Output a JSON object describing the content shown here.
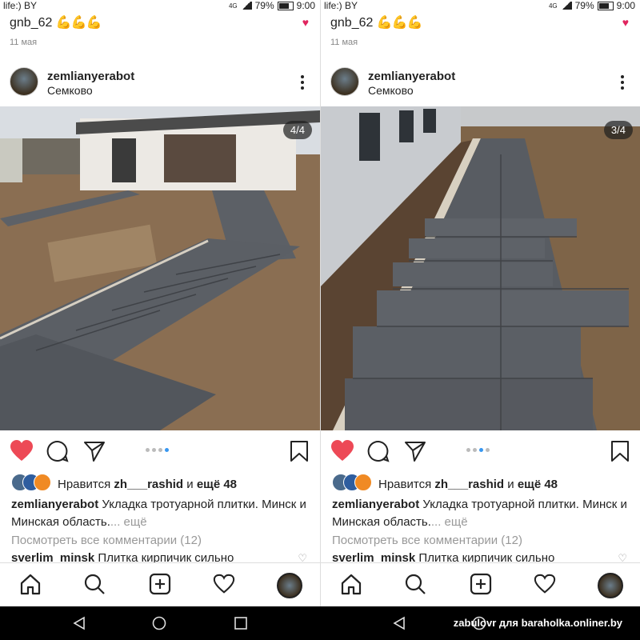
{
  "panels": [
    {
      "status": {
        "carrier": "life:) BY",
        "signal": "4G",
        "battery": "79%",
        "time": "9:00"
      },
      "prev_post": {
        "username": "gnb_62",
        "emoji": "💪💪💪",
        "date": "11 мая"
      },
      "post": {
        "username": "zemlianyerabot",
        "location": "Семково",
        "counter": "4/4",
        "likes_prefix": "Нравится",
        "likes_user": "zh___rashid",
        "likes_mid": "и",
        "likes_more": "ещё 48",
        "caption_user": "zemlianyerabot",
        "caption_text": "Укладка тротуарной плитки. Минск и Минская область.",
        "caption_more": "... ещё",
        "view_comments": "Посмотреть все комментарии (12)",
        "comment_user": "sverlim_minsk",
        "comment_text": "Плитка кирпичик сильно"
      }
    },
    {
      "status": {
        "carrier": "life:) BY",
        "signal": "4G",
        "battery": "79%",
        "time": "9:00"
      },
      "prev_post": {
        "username": "gnb_62",
        "emoji": "💪💪💪",
        "date": "11 мая"
      },
      "post": {
        "username": "zemlianyerabot",
        "location": "Семково",
        "counter": "3/4",
        "likes_prefix": "Нравится",
        "likes_user": "zh___rashid",
        "likes_mid": "и",
        "likes_more": "ещё 48",
        "caption_user": "zemlianyerabot",
        "caption_text": "Укладка тротуарной плитки. Минск и Минская область.",
        "caption_more": "... ещё",
        "view_comments": "Посмотреть все комментарии (12)",
        "comment_user": "sverlim_minsk",
        "comment_text": "Плитка кирпичик сильно"
      }
    }
  ],
  "carousel_active_dot": [
    3,
    2
  ],
  "watermark": "zabulovr для baraholka.onliner.by",
  "colors": {
    "like_red": "#ed4956",
    "dot_blue": "#3897f0"
  }
}
